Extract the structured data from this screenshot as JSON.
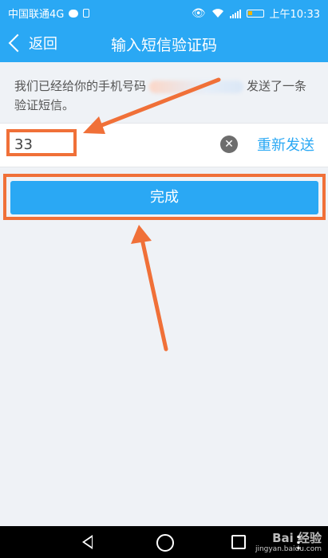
{
  "status_bar": {
    "carrier": "中国联通4G",
    "network_badge": "4G",
    "time": "上午10:33",
    "icons": [
      "chat-icon",
      "sim-icon",
      "eye-icon",
      "wifi-icon",
      "signal-icon",
      "battery-icon"
    ]
  },
  "header": {
    "back_label": "返回",
    "title": "输入短信验证码"
  },
  "info": {
    "text_before": "我们已经给你的手机号码",
    "text_after": "发送了一条验证短信。"
  },
  "code_field": {
    "value": "33"
  },
  "resend_label": "重新发送",
  "done_label": "完成",
  "watermark": {
    "brand": "Bai 经验",
    "url": "jingyan.baidu.com"
  },
  "colors": {
    "accent": "#2aa8f4",
    "highlight": "#f07038",
    "background": "#eff2f6"
  }
}
